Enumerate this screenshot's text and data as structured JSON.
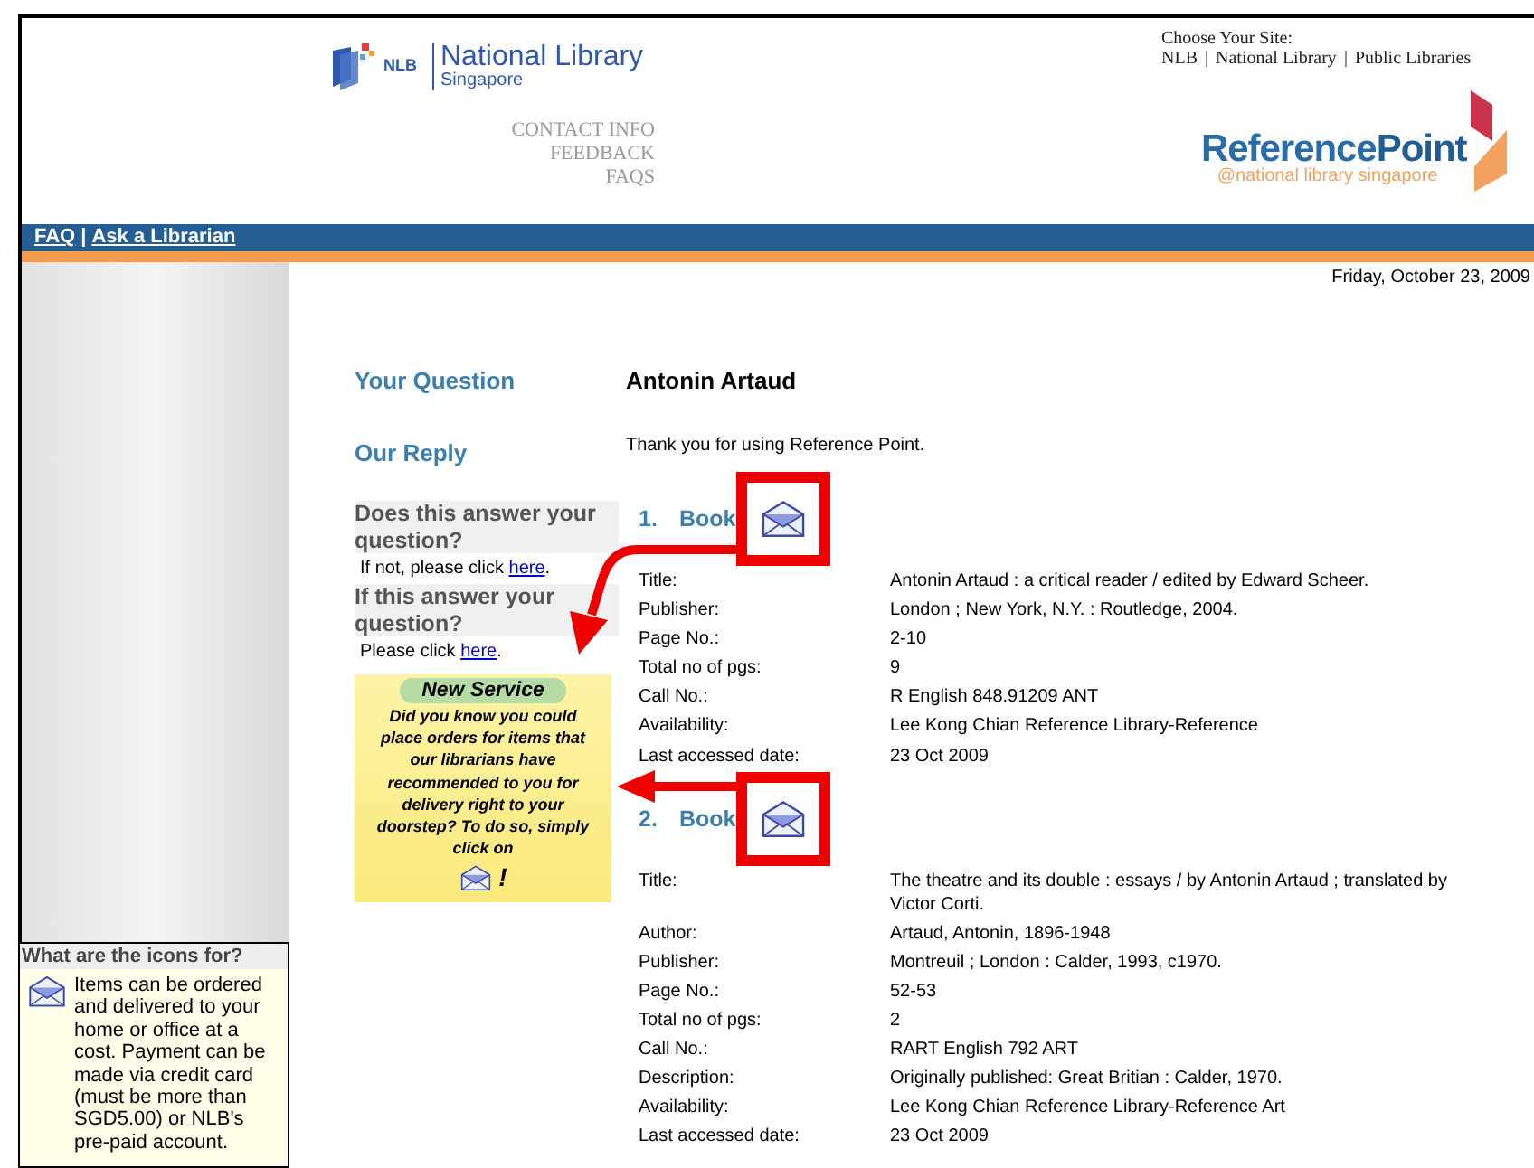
{
  "header": {
    "nlb_logo": {
      "abbr": "NLB",
      "name": "National Library",
      "sub": "Singapore"
    },
    "links": [
      "CONTACT INFO",
      "FEEDBACK",
      "FAQS"
    ],
    "site_chooser": {
      "label": "Choose Your Site:",
      "separator": "|",
      "sites": [
        "NLB",
        "National Library",
        "Public Libraries"
      ]
    },
    "rp_logo": {
      "name_a": "Reference",
      "name_b": "Point",
      "tagline": "@national library singapore"
    }
  },
  "nav": {
    "separator": "|",
    "links": [
      "FAQ",
      "Ask a Librarian"
    ]
  },
  "date": "Friday, October 23, 2009",
  "question": {
    "label": "Your Question",
    "value": "Antonin Artaud"
  },
  "reply": {
    "label": "Our Reply",
    "value": "Thank you for using Reference Point."
  },
  "feedback": [
    {
      "heading": "Does this answer your question?",
      "text": "If not, please click",
      "link": "here",
      "end": "."
    },
    {
      "heading": "If this answer your question?",
      "text": "Please click",
      "link": "here",
      "end": "."
    }
  ],
  "new_service": {
    "title": "New Service",
    "text": "Did you know you could place orders for items that our librarians have recommended to you for delivery right to your doorstep?  To do so, simply click on",
    "end": "!"
  },
  "results": [
    {
      "number": "1.",
      "type": "Book",
      "fields": [
        {
          "label": "Title:",
          "value": "Antonin Artaud : a critical reader / edited by Edward Scheer."
        },
        {
          "label": "Publisher:",
          "value": "London ; New York, N.Y. : Routledge, 2004."
        },
        {
          "label": "Page No.:",
          "value": "2-10"
        },
        {
          "label": "Total no of pgs:",
          "value": "9"
        },
        {
          "label": "Call No.:",
          "value": "R English 848.91209 ANT"
        },
        {
          "label": "Availability:",
          "value": "Lee Kong Chian Reference Library-Reference"
        },
        {
          "label": "Last accessed date:",
          "value": "23 Oct 2009"
        }
      ]
    },
    {
      "number": "2.",
      "type": "Book",
      "fields": [
        {
          "label": "Title:",
          "value": "The theatre and its double : essays / by Antonin Artaud ; translated by Victor Corti."
        },
        {
          "label": "Author:",
          "value": "Artaud, Antonin, 1896-1948"
        },
        {
          "label": "Publisher:",
          "value": "Montreuil ; London : Calder, 1993, c1970."
        },
        {
          "label": "Page No.:",
          "value": "52-53"
        },
        {
          "label": "Total no of pgs:",
          "value": "2"
        },
        {
          "label": "Call No.:",
          "value": "RART English 792 ART"
        },
        {
          "label": "Description:",
          "value": "Originally published: Great Britian : Calder, 1970."
        },
        {
          "label": "Availability:",
          "value": "Lee Kong Chian Reference Library-Reference Art"
        },
        {
          "label": "Last accessed date:",
          "value": "23 Oct 2009"
        }
      ]
    }
  ],
  "icons_help": {
    "title": "What are the icons for?",
    "text": "Items can be ordered and delivered to your home or office at a cost. Payment can be made via credit card (must be more than SGD5.00) or NLB's pre-paid account."
  }
}
